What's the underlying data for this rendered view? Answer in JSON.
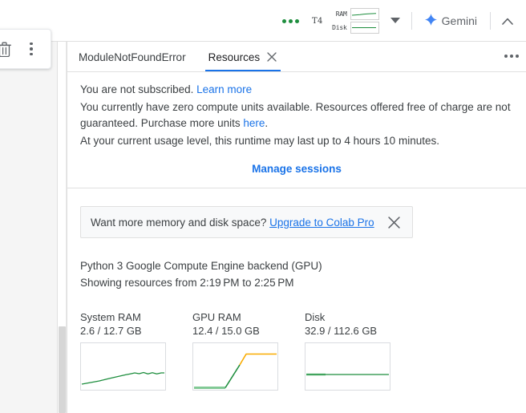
{
  "topbar": {
    "connection_dots_icon": "green-status-dots",
    "accelerator_label": "T4",
    "meters": [
      {
        "label": "RAM",
        "icon": "ram-sparkline"
      },
      {
        "label": "Disk",
        "icon": "disk-sparkline"
      }
    ],
    "dropdown_icon": "caret-down-icon",
    "gemini_label": "Gemini",
    "gemini_icon": "gemini-sparkle-icon",
    "collapse_icon": "chevron-up-icon"
  },
  "left_toolbar": {
    "delete_icon": "trash-icon",
    "more_icon": "more-vertical-icon"
  },
  "tabs": [
    {
      "label": "ModuleNotFoundError",
      "active": false,
      "closable": false
    },
    {
      "label": "Resources",
      "active": true,
      "closable": true
    }
  ],
  "tabbar": {
    "overflow_icon": "more-horizontal-icon",
    "close_icon": "close-icon"
  },
  "subscription": {
    "line1_prefix": "You are not subscribed.",
    "line1_link": "Learn more",
    "line2_part1": "You currently have zero compute units available. Resources offered free of charge are not guaranteed. Purchase more units ",
    "line2_link": "here",
    "line2_part2": ".",
    "line3": "At your current usage level, this runtime may last up to 4 hours 10 minutes.",
    "manage_sessions": "Manage sessions"
  },
  "upgrade_banner": {
    "text": "Want more memory and disk space?",
    "link": "Upgrade to Colab Pro",
    "close_icon": "close-icon"
  },
  "backend": {
    "line1": "Python 3 Google Compute Engine backend (GPU)",
    "line2": "Showing resources from 2:19 PM to 2:25 PM"
  },
  "colors": {
    "accent_blue": "#1a73e8",
    "green": "#1e8e3e",
    "green_light": "#81c995",
    "orange": "#f9ab00",
    "text": "#3c4043",
    "border": "#e0e0e0",
    "banner_bg": "#f8f9fa"
  },
  "chart_data": [
    {
      "type": "line",
      "title": "System RAM",
      "value_label": "2.6 / 12.7 GB",
      "used": 2.6,
      "total": 12.7,
      "unit": "GB",
      "xlabel": "",
      "ylabel": "",
      "ylim": [
        0,
        12.7
      ],
      "grid": false,
      "legend": "none",
      "series": [
        {
          "name": "System RAM",
          "color": "#1e8e3e",
          "values": [
            0.9,
            1.0,
            1.1,
            1.2,
            1.3,
            1.45,
            1.6,
            1.75,
            1.9,
            2.05,
            2.2,
            2.35,
            2.5,
            2.45,
            2.65,
            2.45,
            2.62,
            2.45,
            2.6,
            2.6
          ]
        }
      ]
    },
    {
      "type": "line",
      "title": "GPU RAM",
      "value_label": "12.4 / 15.0 GB",
      "used": 12.4,
      "total": 15.0,
      "unit": "GB",
      "xlabel": "",
      "ylabel": "",
      "ylim": [
        0,
        15.0
      ],
      "grid": false,
      "legend": "none",
      "series": [
        {
          "name": "GPU RAM",
          "color": "#1e8e3e",
          "values": [
            0.2,
            0.2,
            0.2,
            0.2,
            0.2,
            0.2,
            0.2,
            0.2,
            2.6,
            5.2,
            7.8,
            10.4,
            12.4,
            12.4,
            12.4,
            12.4,
            12.4,
            12.4,
            12.4,
            12.4
          ]
        }
      ],
      "annotations": [
        {
          "text": "upper segment drawn in orange (high utilization)",
          "color": "#f9ab00"
        },
        {
          "text": "baseline drawn in light green",
          "color": "#81c995"
        }
      ]
    },
    {
      "type": "line",
      "title": "Disk",
      "value_label": "32.9 / 112.6 GB",
      "used": 32.9,
      "total": 112.6,
      "unit": "GB",
      "xlabel": "",
      "ylabel": "",
      "ylim": [
        0,
        112.6
      ],
      "grid": false,
      "legend": "none",
      "series": [
        {
          "name": "Disk",
          "color": "#1e8e3e",
          "values": [
            32.9,
            32.9,
            32.9,
            32.9,
            32.9,
            32.9,
            32.9,
            32.9,
            32.9,
            32.9,
            32.9,
            32.9,
            32.9,
            32.9,
            32.9,
            32.9,
            32.9,
            32.9,
            32.9,
            32.9
          ]
        }
      ]
    }
  ]
}
